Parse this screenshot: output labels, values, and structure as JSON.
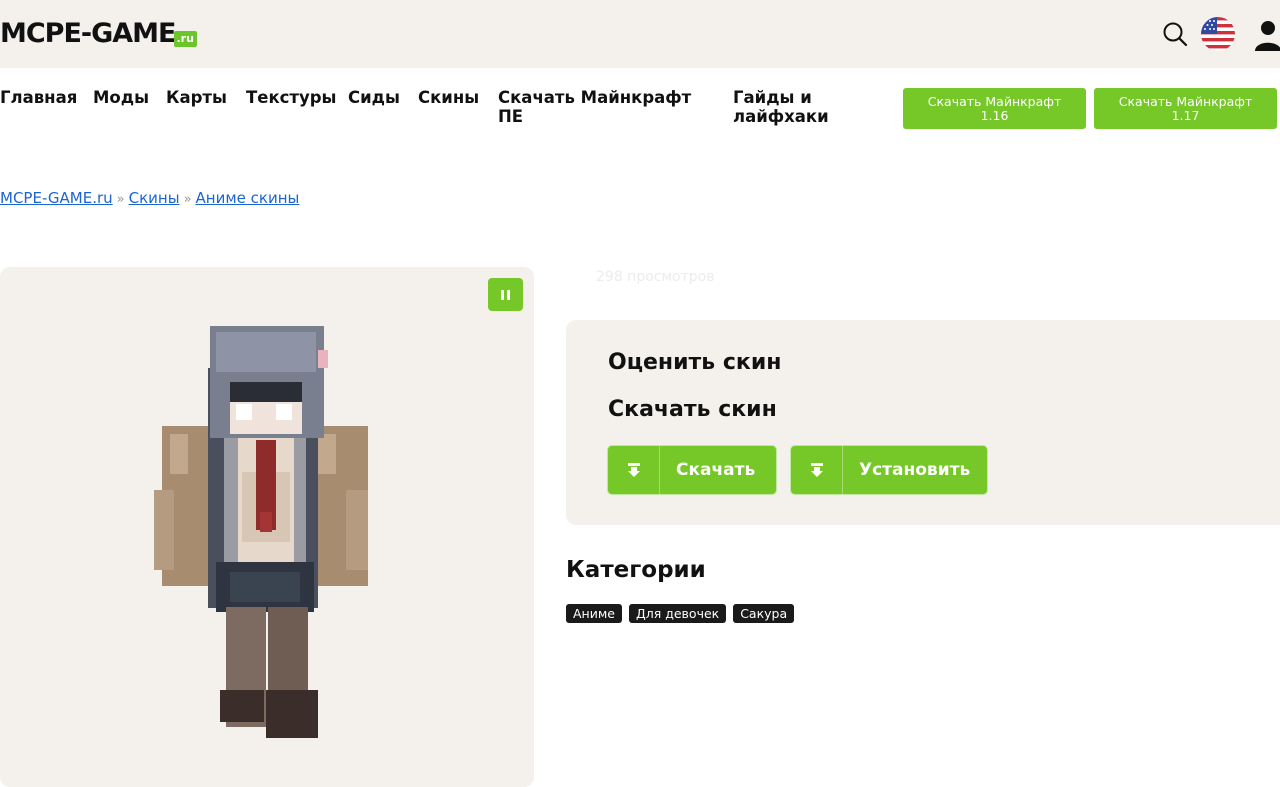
{
  "header": {
    "logo_text": "MCPE-GAME",
    "logo_suffix": ".ru",
    "icons": [
      "search-icon",
      "us-flag-icon",
      "user-icon"
    ]
  },
  "nav": {
    "items": [
      {
        "label": "Главная"
      },
      {
        "label": "Моды"
      },
      {
        "label": "Карты"
      },
      {
        "label": "Текстуры"
      },
      {
        "label": "Сиды"
      },
      {
        "label": "Скины"
      },
      {
        "label_line1": "Скачать Майнкрафт",
        "label_line2": "ПЕ"
      },
      {
        "label_line1": "Гайды и",
        "label_line2": "лайфхаки"
      }
    ],
    "buttons": [
      {
        "line1": "Скачать Майнкрафт",
        "line2": "1.16"
      },
      {
        "line1": "Скачать Майнкрафт",
        "line2": "1.17"
      }
    ]
  },
  "breadcrumb": {
    "items": [
      "MCPE-GAME.ru",
      "Скины",
      "Аниме скины"
    ],
    "separator": "»"
  },
  "skin": {
    "views": "298 просмотров"
  },
  "actions": {
    "rate_heading": "Оценить скин",
    "download_heading": "Скачать скин",
    "download_label": "Скачать",
    "install_label": "Установить"
  },
  "categories": {
    "title": "Категории",
    "tags": [
      "Аниме",
      "Для девочек",
      "Сакура"
    ]
  },
  "colors": {
    "accent_green": "#76c828",
    "panel_bg": "#f4f1ec",
    "link_blue": "#1b65d2",
    "tag_bg": "#1a1a1a"
  }
}
